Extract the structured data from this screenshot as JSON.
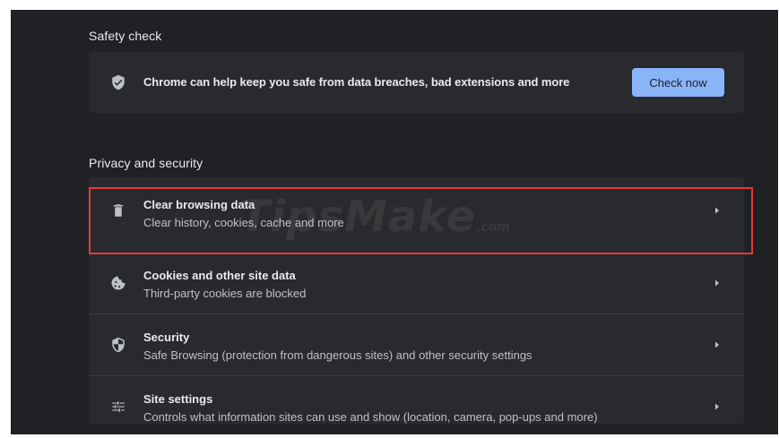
{
  "safety_check": {
    "section_title": "Safety check",
    "message": "Chrome can help keep you safe from data breaches, bad extensions and more",
    "button_label": "Check now",
    "icon": "shield-check-icon"
  },
  "privacy": {
    "section_title": "Privacy and security",
    "items": [
      {
        "title": "Clear browsing data",
        "subtitle": "Clear history, cookies, cache and more",
        "icon": "trash-icon",
        "highlighted": true
      },
      {
        "title": "Cookies and other site data",
        "subtitle": "Third-party cookies are blocked",
        "icon": "cookie-icon"
      },
      {
        "title": "Security",
        "subtitle": "Safe Browsing (protection from dangerous sites) and other security settings",
        "icon": "shield-icon"
      },
      {
        "title": "Site settings",
        "subtitle": "Controls what information sites can use and show (location, camera, pop-ups and more)",
        "icon": "sliders-icon"
      }
    ]
  },
  "watermark": {
    "brand": "TipsMake",
    "suffix": ".com"
  },
  "colors": {
    "background": "#202124",
    "card": "#292a2d",
    "accent_button": "#8ab4f8",
    "highlight_border": "#e53935",
    "text_primary": "#e8eaed",
    "text_secondary": "#bdc1c6"
  }
}
